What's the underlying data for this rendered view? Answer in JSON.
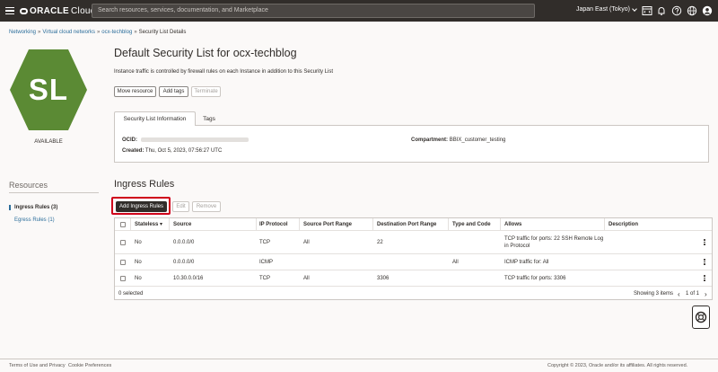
{
  "topbar": {
    "brand": "ORACLE",
    "product": "Cloud",
    "search_placeholder": "Search resources, services, documentation, and Marketplace",
    "region": "Japan East (Tokyo)",
    "icons": [
      "menu-icon",
      "code-editor-icon",
      "bell-icon",
      "help-icon",
      "globe-icon",
      "user-icon"
    ]
  },
  "breadcrumb": {
    "items": [
      "Networking",
      "Virtual cloud networks",
      "ocx-techblog"
    ],
    "current": "Security List Details"
  },
  "avatar": {
    "initials": "SL",
    "color": "#5b8a34",
    "status": "AVAILABLE"
  },
  "page": {
    "title": "Default Security List for ocx-techblog",
    "description": "Instance traffic is controlled by firewall rules on each Instance in addition to this Security List",
    "actions": {
      "move": "Move resource",
      "tags": "Add tags",
      "terminate": "Terminate"
    }
  },
  "tabs": {
    "info": "Security List Information",
    "tags": "Tags"
  },
  "info": {
    "ocid_label": "OCID:",
    "compartment_label": "Compartment:",
    "compartment_value": "BBIX_customer_testing",
    "created_label": "Created:",
    "created_value": "Thu, Oct 5, 2023, 07:56:27 UTC"
  },
  "resources": {
    "title": "Resources",
    "items": [
      "Ingress Rules (3)",
      "Egress Rules (1)"
    ]
  },
  "ingress": {
    "title": "Ingress Rules",
    "add": "Add Ingress Rules",
    "edit": "Edit",
    "remove": "Remove",
    "columns": [
      "Stateless",
      "Source",
      "IP Protocol",
      "Source Port Range",
      "Destination Port Range",
      "Type and Code",
      "Allows",
      "Description"
    ],
    "rows": [
      {
        "stateless": "No",
        "source": "0.0.0.0/0",
        "protocol": "TCP",
        "src_port": "All",
        "dst_port": "22",
        "type_code": "",
        "allows_1": "TCP traffic for ports: 22 SSH Remote Log",
        "allows_2": "in Protocol",
        "description": ""
      },
      {
        "stateless": "No",
        "source": "0.0.0.0/0",
        "protocol": "ICMP",
        "src_port": "",
        "dst_port": "",
        "type_code": "All",
        "allows_1": "ICMP traffic for: All",
        "allows_2": "",
        "description": ""
      },
      {
        "stateless": "No",
        "source": "10.30.0.0/16",
        "protocol": "TCP",
        "src_port": "All",
        "dst_port": "3306",
        "type_code": "",
        "allows_1": "TCP traffic for ports: 3306",
        "allows_2": "",
        "description": ""
      }
    ],
    "selected": "0 selected",
    "showing": "Showing 3 items",
    "page": "1 of 1"
  },
  "footer": {
    "terms": "Terms of Use and Privacy",
    "cookies": "Cookie Preferences",
    "copyright": "Copyright © 2023, Oracle and/or its affiliates. All rights reserved."
  }
}
